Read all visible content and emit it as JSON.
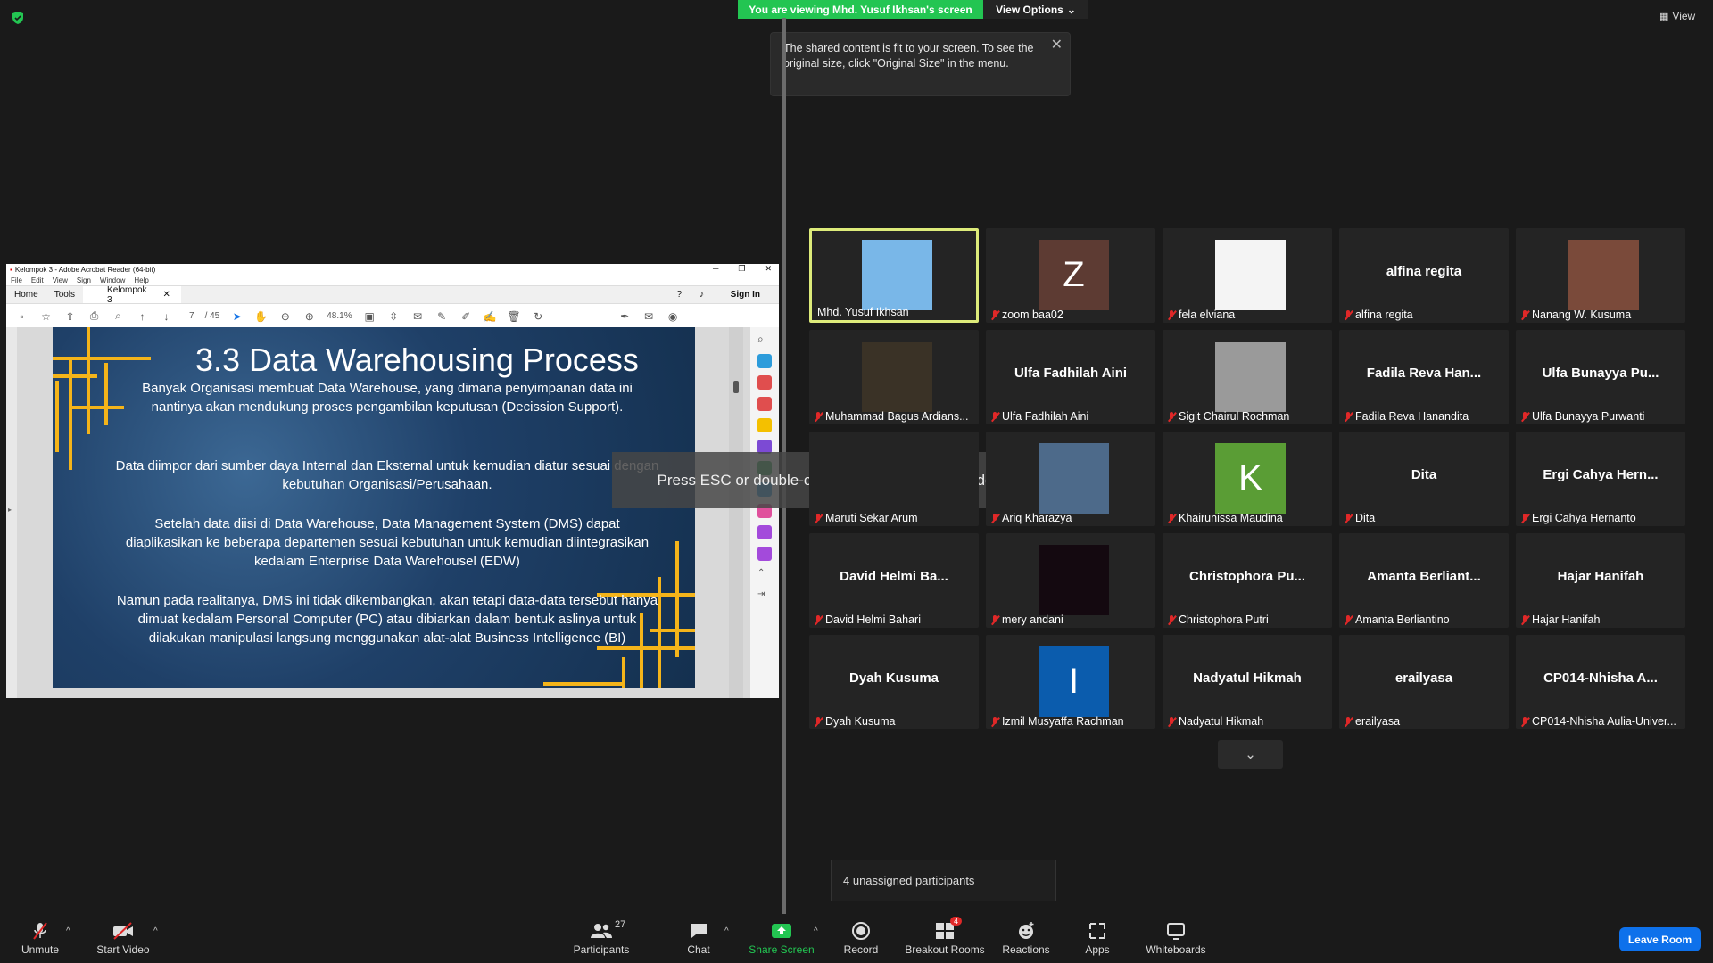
{
  "banner": {
    "viewing": "You are viewing Mhd. Yusuf Ikhsan's screen",
    "view_options": "View Options"
  },
  "tooltip": {
    "text": "The shared content is fit to your screen. To see the original size, click \"Original Size\" in the menu."
  },
  "top_right": {
    "view": "View"
  },
  "fullscreen_message": "Press ESC or double-click to exit full screen mode",
  "acrobat": {
    "title": "Kelompok 3 - Adobe Acrobat Reader (64-bit)",
    "menu": [
      "File",
      "Edit",
      "View",
      "Sign",
      "Window",
      "Help"
    ],
    "tabs": {
      "home": "Home",
      "tools": "Tools",
      "doc": "Kelompok 3"
    },
    "sign_in": "Sign In",
    "page_current": "7",
    "page_total": "/ 45",
    "zoom": "48.1%"
  },
  "slide": {
    "title": "3.3 Data Warehousing Process",
    "p1": "Banyak Organisasi membuat Data Warehouse,  yang dimana penyimpanan data ini nantinya akan mendukung proses pengambilan keputusan (Decission Support).",
    "p2": "Data diimpor dari sumber daya Internal dan Eksternal untuk kemudian diatur sesuai dengan kebutuhan Organisasi/Perusahaan.",
    "p3": "Setelah data diisi di Data Warehouse, Data Management System (DMS) dapat diaplikasikan ke beberapa departemen sesuai kebutuhan untuk kemudian diintegrasikan kedalam Enterprise Data Warehousel (EDW)",
    "p4": "Namun pada realitanya, DMS ini tidak dikembangkan, akan tetapi data-data tersebut hanya dimuat kedalam Personal Computer (PC) atau dibiarkan dalam bentuk aslinya untuk dilakukan manipulasi langsung menggunakan alat-alat Business Intelligence (BI)"
  },
  "participants": [
    {
      "name": "Mhd. Yusuf Ikhsan",
      "big": "",
      "avatar": "photo",
      "color": "#79b7e8",
      "muted": false
    },
    {
      "name": "zoom baa02",
      "big": "",
      "avatar": "Z",
      "color": "#5d3b33",
      "muted": true
    },
    {
      "name": "fela elviana",
      "big": "",
      "avatar": "photo",
      "color": "#f4f4f4",
      "muted": true
    },
    {
      "name": "alfina regita",
      "big": "alfina regita",
      "avatar": "",
      "color": "",
      "muted": true
    },
    {
      "name": "Nanang W. Kusuma",
      "big": "",
      "avatar": "photo",
      "color": "#7a4a3a",
      "muted": true
    },
    {
      "name": "Muhammad Bagus Ardians...",
      "big": "",
      "avatar": "photo",
      "color": "#3a3226",
      "muted": true
    },
    {
      "name": "Ulfa Fadhilah Aini",
      "big": "Ulfa Fadhilah Aini",
      "avatar": "",
      "color": "",
      "muted": true
    },
    {
      "name": "Sigit Chairul Rochman",
      "big": "",
      "avatar": "photo",
      "color": "#9a9a9a",
      "muted": true
    },
    {
      "name": "Fadila Reva Hanandita",
      "big": "Fadila Reva Han...",
      "avatar": "",
      "color": "",
      "muted": true
    },
    {
      "name": "Ulfa Bunayya Purwanti",
      "big": "Ulfa Bunayya Pu...",
      "avatar": "",
      "color": "",
      "muted": true
    },
    {
      "name": "Maruti Sekar Arum",
      "big": "",
      "avatar": "",
      "color": "",
      "muted": true
    },
    {
      "name": "Ariq Kharazya",
      "big": "",
      "avatar": "photo",
      "color": "#4d6a8a",
      "muted": true
    },
    {
      "name": "Khairunissa Maudina",
      "big": "",
      "avatar": "K",
      "color": "#5a9d35",
      "muted": true
    },
    {
      "name": "Dita",
      "big": "Dita",
      "avatar": "",
      "color": "",
      "muted": true
    },
    {
      "name": "Ergi Cahya Hernanto",
      "big": "Ergi Cahya Hern...",
      "avatar": "",
      "color": "",
      "muted": true
    },
    {
      "name": "David Helmi Bahari",
      "big": "David Helmi Ba...",
      "avatar": "",
      "color": "",
      "muted": true
    },
    {
      "name": "mery andani",
      "big": "",
      "avatar": "photo",
      "color": "#140910",
      "muted": true
    },
    {
      "name": "Christophora Putri",
      "big": "Christophora  Pu...",
      "avatar": "",
      "color": "",
      "muted": true
    },
    {
      "name": "Amanta Berliantino",
      "big": "Amanta Berliant...",
      "avatar": "",
      "color": "",
      "muted": true
    },
    {
      "name": "Hajar Hanifah",
      "big": "Hajar Hanifah",
      "avatar": "",
      "color": "",
      "muted": true
    },
    {
      "name": "Dyah Kusuma",
      "big": "Dyah Kusuma",
      "avatar": "",
      "color": "",
      "muted": true
    },
    {
      "name": "Izmil Musyaffa Rachman",
      "big": "",
      "avatar": "I",
      "color": "#0b5cad",
      "muted": true
    },
    {
      "name": "Nadyatul Hikmah",
      "big": "Nadyatul Hikmah",
      "avatar": "",
      "color": "",
      "muted": true
    },
    {
      "name": "erailyasa",
      "big": "erailyasa",
      "avatar": "",
      "color": "",
      "muted": true
    },
    {
      "name": "CP014-Nhisha Aulia-Univer...",
      "big": "CP014-Nhisha A...",
      "avatar": "",
      "color": "",
      "muted": true
    }
  ],
  "unassigned": "4 unassigned participants",
  "toolbar": {
    "unmute": "Unmute",
    "start_video": "Start Video",
    "participants": "Participants",
    "participants_count": "27",
    "chat": "Chat",
    "share_screen": "Share Screen",
    "record": "Record",
    "breakout_rooms": "Breakout Rooms",
    "breakout_badge": "4",
    "reactions": "Reactions",
    "apps": "Apps",
    "whiteboards": "Whiteboards",
    "leave_room": "Leave Room"
  },
  "colors": {
    "share_green": "#23c552",
    "leave_blue": "#0e71eb",
    "active_speaker": "#ddeb7a",
    "muted_red": "#e02828"
  }
}
